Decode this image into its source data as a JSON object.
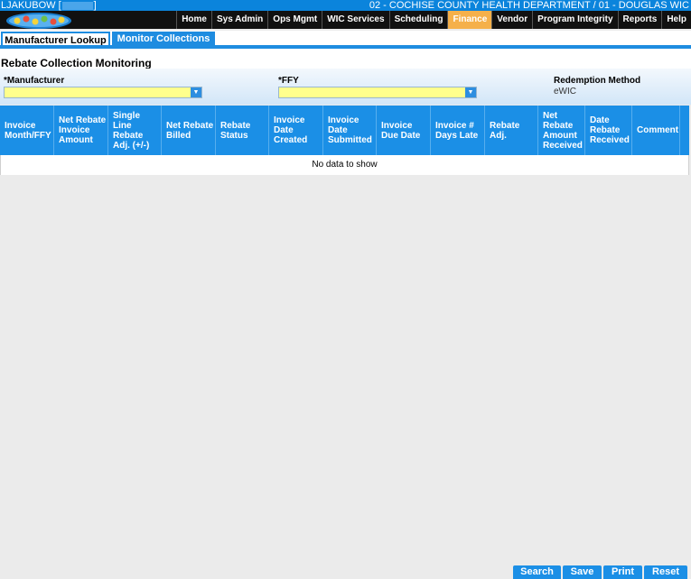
{
  "topbar": {
    "user": "LJAKUBOW [",
    "user_end": "]",
    "clinic": "02 - COCHISE COUNTY HEALTH DEPARTMENT / 01 - DOUGLAS WIC"
  },
  "nav": {
    "items": [
      "Home",
      "Sys Admin",
      "Ops Mgmt",
      "WIC Services",
      "Scheduling",
      "Finance",
      "Vendor",
      "Program Integrity",
      "Reports",
      "Help"
    ],
    "active": "Finance",
    "active_color": "#f5b04a"
  },
  "tabs": [
    {
      "label": "Manufacturer Lookup"
    },
    {
      "label": "Monitor Collections"
    }
  ],
  "page_title": "Rebate Collection Monitoring",
  "filters": {
    "manufacturer_label": "*Manufacturer",
    "manufacturer_value": "",
    "ffy_label": "*FFY",
    "ffy_value": "",
    "redemption_label": "Redemption Method",
    "redemption_value": "eWIC"
  },
  "grid": {
    "columns": [
      "Invoice Month/FFY",
      "Net Rebate Invoice Amount",
      "Single Line Rebate Adj. (+/-)",
      "Net Rebate Billed",
      "Rebate Status",
      "Invoice Date Created",
      "Invoice Date Submitted",
      "Invoice Due Date",
      "Invoice # Days Late",
      "Rebate Adj.",
      "Net Rebate Amount Received",
      "Date Rebate Received",
      "Comment"
    ],
    "empty_text": "No data to show"
  },
  "buttons": {
    "search": "Search",
    "save": "Save",
    "print": "Print",
    "reset": "Reset"
  },
  "colors": {
    "accent": "#1b8fe6",
    "input_bg": "#ffff8d"
  }
}
